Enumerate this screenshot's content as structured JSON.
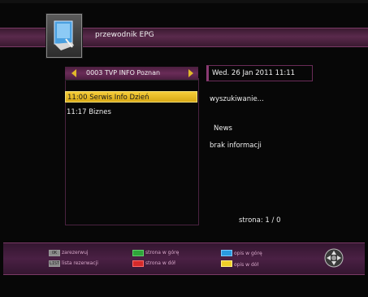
{
  "header": {
    "title": "przewodnik EPG",
    "icon": "epg-guide-icon"
  },
  "channel": {
    "name": "0003 TVP INFO Poznan",
    "prev_icon": "arrow-left-icon",
    "next_icon": "arrow-right-icon"
  },
  "events": [
    {
      "label": "11:00  Serwis Info Dzień",
      "selected": true
    },
    {
      "label": "11:17  Biznes",
      "selected": false
    }
  ],
  "details": {
    "datetime": "Wed.   26 Jan 2011 11:11",
    "search_status": "wyszukiwanie...",
    "genre": "News",
    "info": "brak informacji",
    "page": "strona: 1 / 0"
  },
  "footer": {
    "ok_key": "OK",
    "ok_label": "zarezerwuj",
    "list_key": "LIST",
    "list_label": "lista rezerwacji",
    "green_label": "strona w górę",
    "red_label": "strona w dół",
    "blue_label": "opis w górę",
    "yellow_label": "opis w dół",
    "nav_icon": "navigation-pad-icon"
  },
  "colors": {
    "accent_magenta": "#5a2a4c",
    "highlight_yellow": "#f5cc3a",
    "key_green": "#2fa43a",
    "key_red": "#d42a2a",
    "key_blue": "#2a9ae0",
    "key_yellow": "#f0cf28"
  }
}
